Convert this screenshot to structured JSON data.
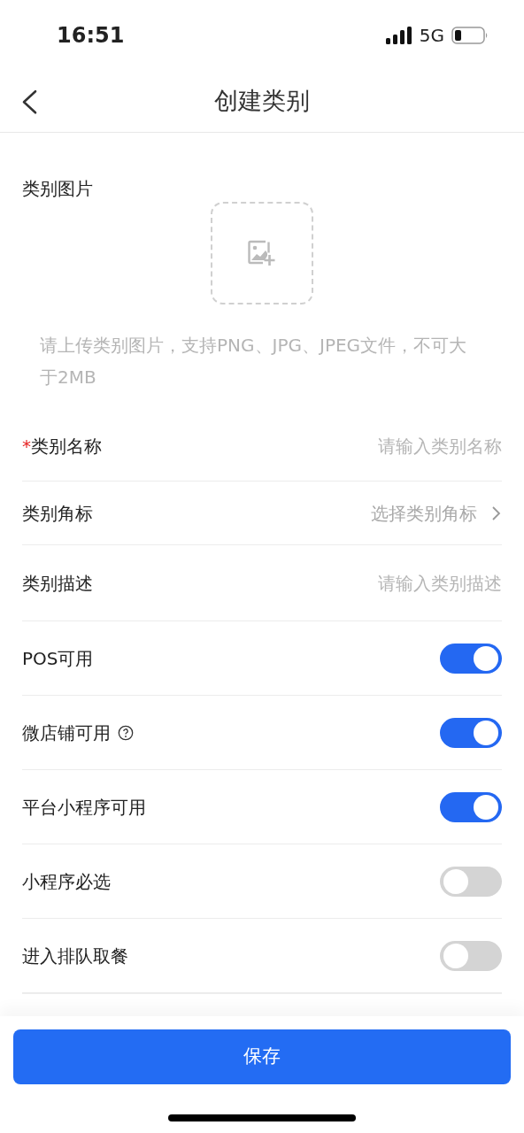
{
  "status_bar": {
    "time": "16:51",
    "network": "5G"
  },
  "nav": {
    "title": "创建类别"
  },
  "image_section": {
    "label": "类别图片",
    "hint": "请上传类别图片，支持PNG、JPG、JPEG文件，不可大于2MB"
  },
  "required_marker": "*",
  "fields": [
    {
      "kind": "input",
      "label": "类别名称",
      "required": true,
      "placeholder": "请输入类别名称"
    },
    {
      "kind": "select",
      "label": "类别角标",
      "required": false,
      "placeholder": "选择类别角标"
    },
    {
      "kind": "input",
      "label": "类别描述",
      "required": false,
      "placeholder": "请输入类别描述"
    },
    {
      "kind": "toggle",
      "label": "POS可用",
      "required": false,
      "help": false,
      "on": true
    },
    {
      "kind": "toggle",
      "label": "微店铺可用",
      "required": false,
      "help": true,
      "on": true
    },
    {
      "kind": "toggle",
      "label": "平台小程序可用",
      "required": false,
      "help": false,
      "on": true
    },
    {
      "kind": "toggle",
      "label": "小程序必选",
      "required": false,
      "help": false,
      "on": false
    },
    {
      "kind": "toggle",
      "label": "进入排队取餐",
      "required": false,
      "help": false,
      "on": false
    }
  ],
  "save_button": "保存"
}
